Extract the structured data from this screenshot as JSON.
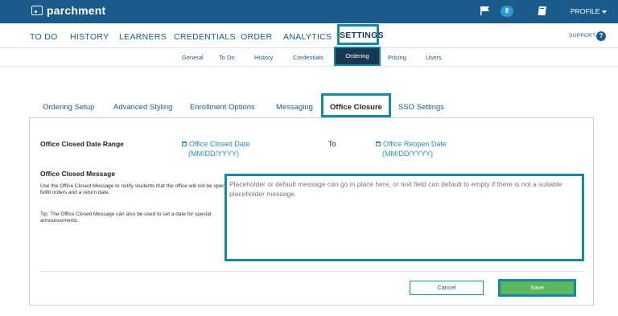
{
  "header": {
    "logo_text": "parchment",
    "badge_count": "8",
    "profile_label": "PROFILE"
  },
  "main_nav": {
    "items": [
      "TO DO",
      "HISTORY",
      "LEARNERS",
      "CREDENTIALS",
      "ORDER",
      "ANALYTICS"
    ],
    "active": "SETTINGS",
    "support": "SUPPORT",
    "help_glyph": "?"
  },
  "sub_nav": {
    "items": [
      "General",
      "To Do",
      "History",
      "Credentials"
    ],
    "active": "Ordering",
    "after": [
      "Pricing",
      "Users"
    ]
  },
  "tabs": {
    "items": [
      "Ordering Setup",
      "Advanced Styling",
      "Enrollment Options",
      "Messaging"
    ],
    "active": "Office Closure",
    "after": [
      "SSO Settings"
    ]
  },
  "form": {
    "date_range_label": "Office Closed Date Range",
    "closed_date_line1": "Office Closed Date",
    "closed_date_line2": "(MM/DD/YYYY)",
    "to_label": "To",
    "reopen_date_line1": "Office Reopen Date",
    "reopen_date_line2": "(MM/DD/YYYY)",
    "message_label": "Office Closed Message",
    "help_text": "Use the Office Closed Message to notify students that the office will not be open to fulfill orders and a return date.",
    "tip_text": "Tip: The Office Closed Message can also be used to set a date for special announcements.",
    "message_placeholder": "Placeholder or default message can go in place here, or text field can default to empty if there is not a suitable placeholder message.",
    "cancel_label": "Cancel",
    "save_label": "Save"
  },
  "colors": {
    "header_bg": "#1a5b8c",
    "highlight": "#1589a5",
    "link": "#2c8bc9",
    "save_bg": "#5cb85c"
  }
}
